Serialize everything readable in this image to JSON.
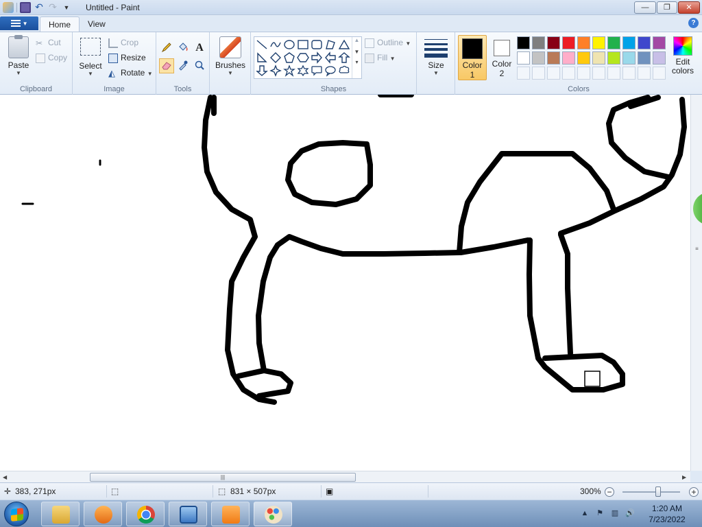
{
  "window": {
    "title": "Untitled - Paint",
    "min_glyph": "—",
    "max_glyph": "❐",
    "close_glyph": "✕"
  },
  "tabs": [
    {
      "label": "Home",
      "active": true
    },
    {
      "label": "View",
      "active": false
    }
  ],
  "help_glyph": "?",
  "ribbon": {
    "clipboard": {
      "group_label": "Clipboard",
      "paste": "Paste",
      "cut": "Cut",
      "copy": "Copy"
    },
    "image": {
      "group_label": "Image",
      "select": "Select",
      "crop": "Crop",
      "resize": "Resize",
      "rotate": "Rotate"
    },
    "tools": {
      "group_label": "Tools",
      "text_tool_glyph": "A",
      "active_tool": "eraser"
    },
    "brushes": {
      "label": "Brushes"
    },
    "shapes": {
      "group_label": "Shapes",
      "outline": "Outline",
      "fill": "Fill"
    },
    "size": {
      "label": "Size"
    },
    "colors": {
      "group_label": "Colors",
      "color1_label_l1": "Color",
      "color1_label_l2": "1",
      "color2_label_l1": "Color",
      "color2_label_l2": "2",
      "color1": "#000000",
      "color2": "#ffffff",
      "edit_l1": "Edit",
      "edit_l2": "colors",
      "palette_row1": [
        "#000000",
        "#7f7f7f",
        "#880015",
        "#ed1c24",
        "#ff7f27",
        "#fff200",
        "#22b14c",
        "#00a2e8",
        "#3f48cc",
        "#a349a4"
      ],
      "palette_row2": [
        "#ffffff",
        "#c3c3c3",
        "#b97a57",
        "#ffaec9",
        "#ffc90e",
        "#efe4b0",
        "#b5e61d",
        "#99d9ea",
        "#7092be",
        "#c8bfe7"
      ]
    }
  },
  "status": {
    "cursor_pos": "383, 271px",
    "canvas_size": "831 × 507px",
    "zoom": "300%",
    "zoom_minus": "−",
    "zoom_plus": "+"
  },
  "taskbar": {
    "apps": [
      "Windows Explorer",
      "Windows Media Player",
      "Google Chrome",
      "Remote Desktop",
      "Store",
      "Paint"
    ],
    "time": "1:20 AM",
    "date": "7/23/2022"
  }
}
